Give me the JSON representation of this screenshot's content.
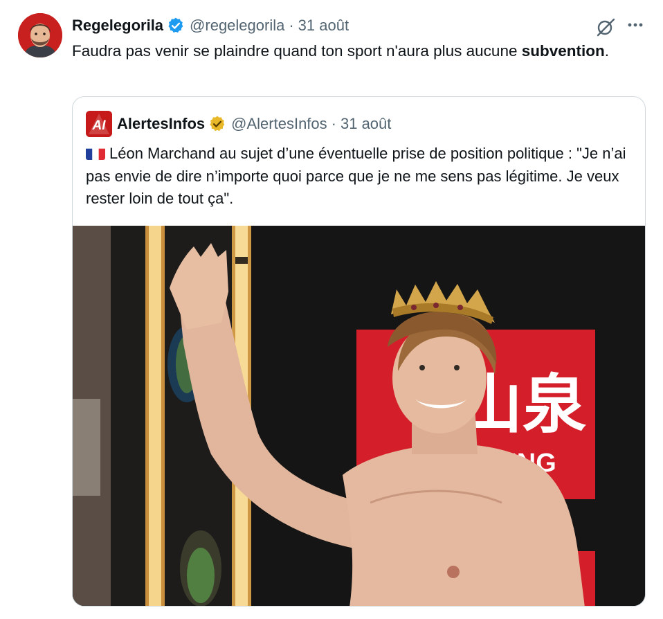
{
  "tweet": {
    "display_name": "Regelegorila",
    "handle": "@regelegorila",
    "separator": "·",
    "date": "31 août",
    "text_before": "Faudra pas venir se plaindre quand ton sport n'aura plus aucune ",
    "text_bold": "subvention",
    "text_after": "."
  },
  "quoted": {
    "display_name": "AlertesInfos",
    "handle": "@AlertesInfos",
    "separator": "·",
    "date": "31 août",
    "flag_icon": "flag-france-icon",
    "text": "Léon Marchand au sujet d’une éventuelle prise de position politique : \"Je n’ai pas envie de dire n’importe quoi parce que je ne me sens pas légitime. Je veux rester loin de tout ça\".",
    "logo_text": "AI",
    "photo_sign_text": "山泉",
    "photo_sign_sub": "ING"
  },
  "icons": {
    "verified": "verified-badge-icon",
    "grok": "grok-icon",
    "more": "more-options-icon"
  },
  "colors": {
    "verified_blue": "#1d9bf0",
    "verified_gold": "#e8b828",
    "text_primary": "#0f1419",
    "text_secondary": "#536471",
    "border": "#cfd9de"
  }
}
